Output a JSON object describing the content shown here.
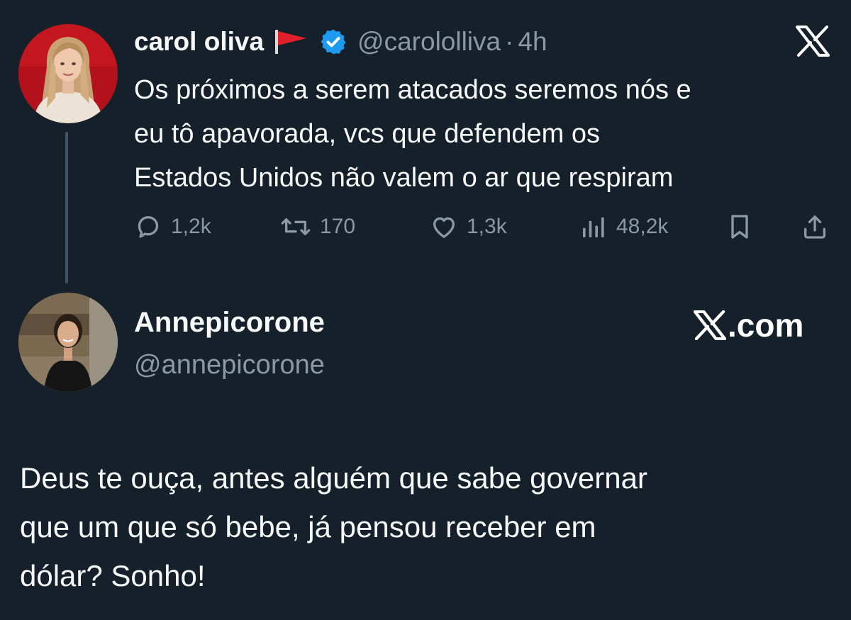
{
  "original_tweet": {
    "author": {
      "display_name": "carol oliva",
      "emoji": "triangular-flag-emoji",
      "verified": true,
      "handle": "@carololliva",
      "separator": "·",
      "time": "4h"
    },
    "text_lines": [
      "Os próximos a serem atacados seremos nós e",
      "eu tô apavorada, vcs que defendem os",
      "Estados Unidos não valem o ar que respiram"
    ],
    "stats": {
      "replies": "1,2k",
      "retweets": "170",
      "likes": "1,3k",
      "views": "48,2k"
    },
    "icons": [
      "reply-icon",
      "retweet-icon",
      "like-icon",
      "views-icon",
      "bookmark-icon",
      "share-icon",
      "x-logo-icon"
    ]
  },
  "reply": {
    "display_name": "Annepicorone",
    "handle": "@annepicorone",
    "brand_suffix": ".com",
    "text_lines": [
      "Deus te ouça, antes alguém que sabe governar",
      "que um que só bebe, já pensou receber em",
      "dólar? Sonho!"
    ]
  },
  "colors": {
    "background": "#15202b",
    "text_primary": "#f7f9f9",
    "text_secondary": "#8b98a5",
    "verified_blue": "#1d9bf0",
    "thread_line": "#425364",
    "flag_red": "#e0202a"
  }
}
